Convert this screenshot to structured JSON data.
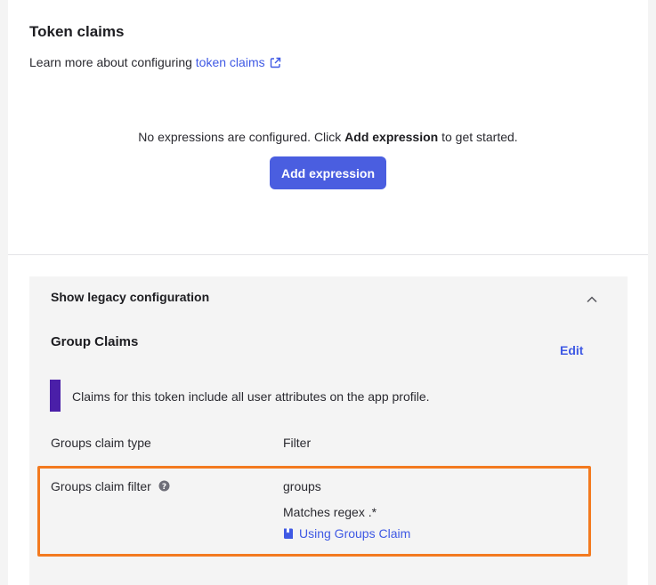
{
  "section": {
    "title": "Token claims",
    "learn_more_prefix": "Learn more about configuring ",
    "learn_more_link": "token claims"
  },
  "empty_state": {
    "message_prefix": "No expressions are configured. Click ",
    "message_bold": "Add expression",
    "message_suffix": " to get started.",
    "button_label": "Add expression"
  },
  "legacy": {
    "toggle_label": "Show legacy configuration",
    "group_title": "Group Claims",
    "edit_label": "Edit",
    "callout": "Claims for this token include all user attributes on the app profile.",
    "rows": {
      "type_label": "Groups claim type",
      "type_value": "Filter",
      "filter_label": "Groups claim filter",
      "filter_value": "groups",
      "filter_match": "Matches regex .*",
      "doc_link": "Using Groups Claim"
    }
  },
  "colors": {
    "link": "#3f59e4",
    "primary_button": "#4a5ee0",
    "callout_bar": "#4a1fa8",
    "highlight_border": "#f37a1f"
  },
  "icons": {
    "external_link": "external-link-icon",
    "chevron": "chevron-up-icon",
    "help": "help-circle-icon",
    "doc": "book-icon"
  }
}
